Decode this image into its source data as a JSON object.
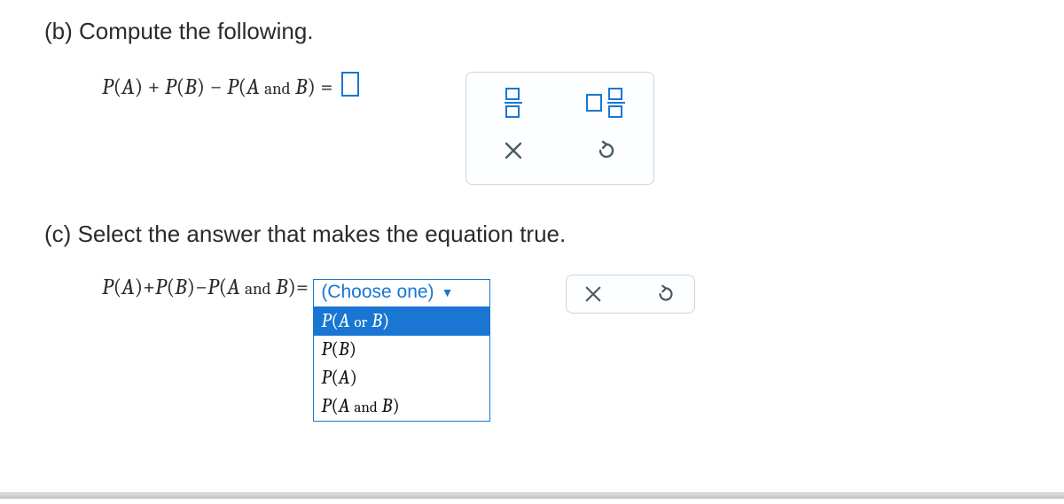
{
  "partB": {
    "label": "(b)",
    "prompt": "Compute the following.",
    "lhs_plain": "P(A) + P(B) − P(A and B) =",
    "answer_value": ""
  },
  "partC": {
    "label": "(c)",
    "prompt": "Select the answer that makes the equation true.",
    "lhs_plain": "P(A) + P(B) − P(A and B) =",
    "dropdown": {
      "placeholder": "(Choose one)",
      "selected_index": 0,
      "options_plain": [
        "P(A or B)",
        "P(B)",
        "P(A)",
        "P(A and B)"
      ]
    }
  },
  "tools": {
    "fraction": "fraction-template",
    "mixed_fraction": "mixed-number-template",
    "clear": "clear",
    "undo": "undo"
  }
}
